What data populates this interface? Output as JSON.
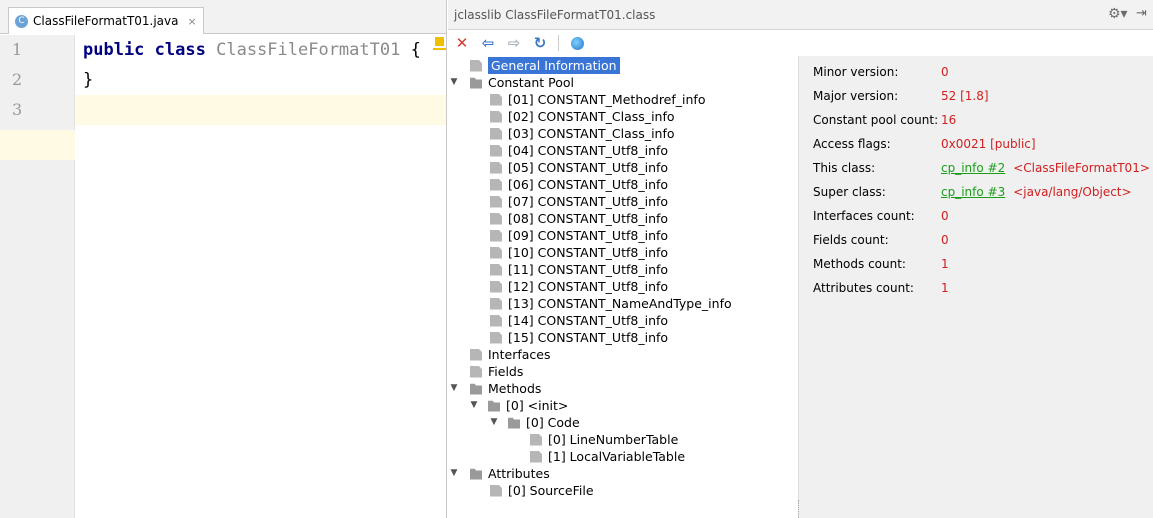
{
  "editor": {
    "tab": {
      "icon_letter": "C",
      "label": "ClassFileFormatT01.java",
      "close": "×"
    },
    "line_numbers": [
      "1",
      "2",
      "3"
    ],
    "lines": [
      {
        "kw1": "public",
        "kw2": "class",
        "name": "ClassFileFormatT01",
        "brace": "{"
      },
      {
        "text": "}"
      },
      {
        "text": ""
      }
    ]
  },
  "tool": {
    "title": "jclasslib ClassFileFormatT01.class",
    "header_icons": {
      "gear": "⚙▾",
      "hide": "⇥"
    },
    "toolbar": {
      "close": "✕",
      "back": "⇦",
      "forward": "⇨",
      "refresh": "↻"
    },
    "tree": [
      {
        "label": "General Information",
        "selected": true
      },
      {
        "label": "Constant Pool"
      },
      {
        "label": "[01] CONSTANT_Methodref_info"
      },
      {
        "label": "[02] CONSTANT_Class_info"
      },
      {
        "label": "[03] CONSTANT_Class_info"
      },
      {
        "label": "[04] CONSTANT_Utf8_info"
      },
      {
        "label": "[05] CONSTANT_Utf8_info"
      },
      {
        "label": "[06] CONSTANT_Utf8_info"
      },
      {
        "label": "[07] CONSTANT_Utf8_info"
      },
      {
        "label": "[08] CONSTANT_Utf8_info"
      },
      {
        "label": "[09] CONSTANT_Utf8_info"
      },
      {
        "label": "[10] CONSTANT_Utf8_info"
      },
      {
        "label": "[11] CONSTANT_Utf8_info"
      },
      {
        "label": "[12] CONSTANT_Utf8_info"
      },
      {
        "label": "[13] CONSTANT_NameAndType_info"
      },
      {
        "label": "[14] CONSTANT_Utf8_info"
      },
      {
        "label": "[15] CONSTANT_Utf8_info"
      },
      {
        "label": "Interfaces"
      },
      {
        "label": "Fields"
      },
      {
        "label": "Methods"
      },
      {
        "label": "[0] <init>"
      },
      {
        "label": "[0] Code"
      },
      {
        "label": "[0] LineNumberTable"
      },
      {
        "label": "[1] LocalVariableTable"
      },
      {
        "label": "Attributes"
      },
      {
        "label": "[0] SourceFile"
      }
    ],
    "details": {
      "minor_version": {
        "label": "Minor version:",
        "value": "0"
      },
      "major_version": {
        "label": "Major version:",
        "value": "52 [1.8]"
      },
      "constant_pool_count": {
        "label": "Constant pool count:",
        "value": "16"
      },
      "access_flags": {
        "label": "Access flags:",
        "value": "0x0021 [public]"
      },
      "this_class": {
        "label": "This class:",
        "link": "cp_info #2",
        "value": "<ClassFileFormatT01>"
      },
      "super_class": {
        "label": "Super class:",
        "link": "cp_info #3",
        "value": "<java/lang/Object>"
      },
      "interfaces_count": {
        "label": "Interfaces count:",
        "value": "0"
      },
      "fields_count": {
        "label": "Fields count:",
        "value": "0"
      },
      "methods_count": {
        "label": "Methods count:",
        "value": "1"
      },
      "attributes_count": {
        "label": "Attributes count:",
        "value": "1"
      }
    }
  }
}
